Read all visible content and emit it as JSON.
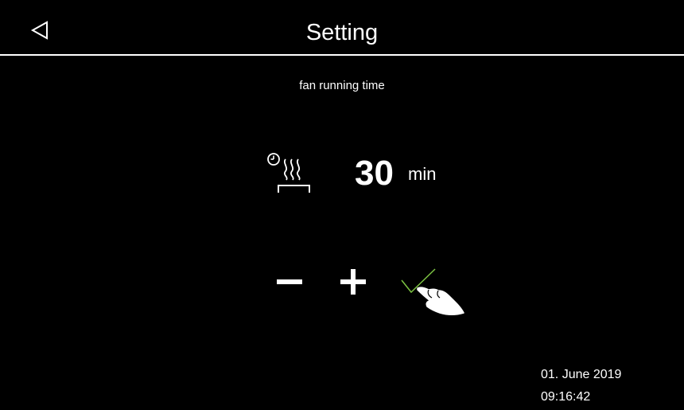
{
  "header": {
    "title": "Setting",
    "back_icon": "back-triangle-icon"
  },
  "setting": {
    "name": "fan running time",
    "icon": "fan-runtime-icon",
    "value": "30",
    "unit": "min"
  },
  "controls": {
    "decrease_icon": "minus-icon",
    "increase_icon": "plus-icon",
    "confirm_icon": "checkmark-icon",
    "pointer_icon": "hand-pointer-icon",
    "confirm_color": "#7cc242"
  },
  "status": {
    "date": "01. June 2019",
    "time": "09:16:42"
  }
}
